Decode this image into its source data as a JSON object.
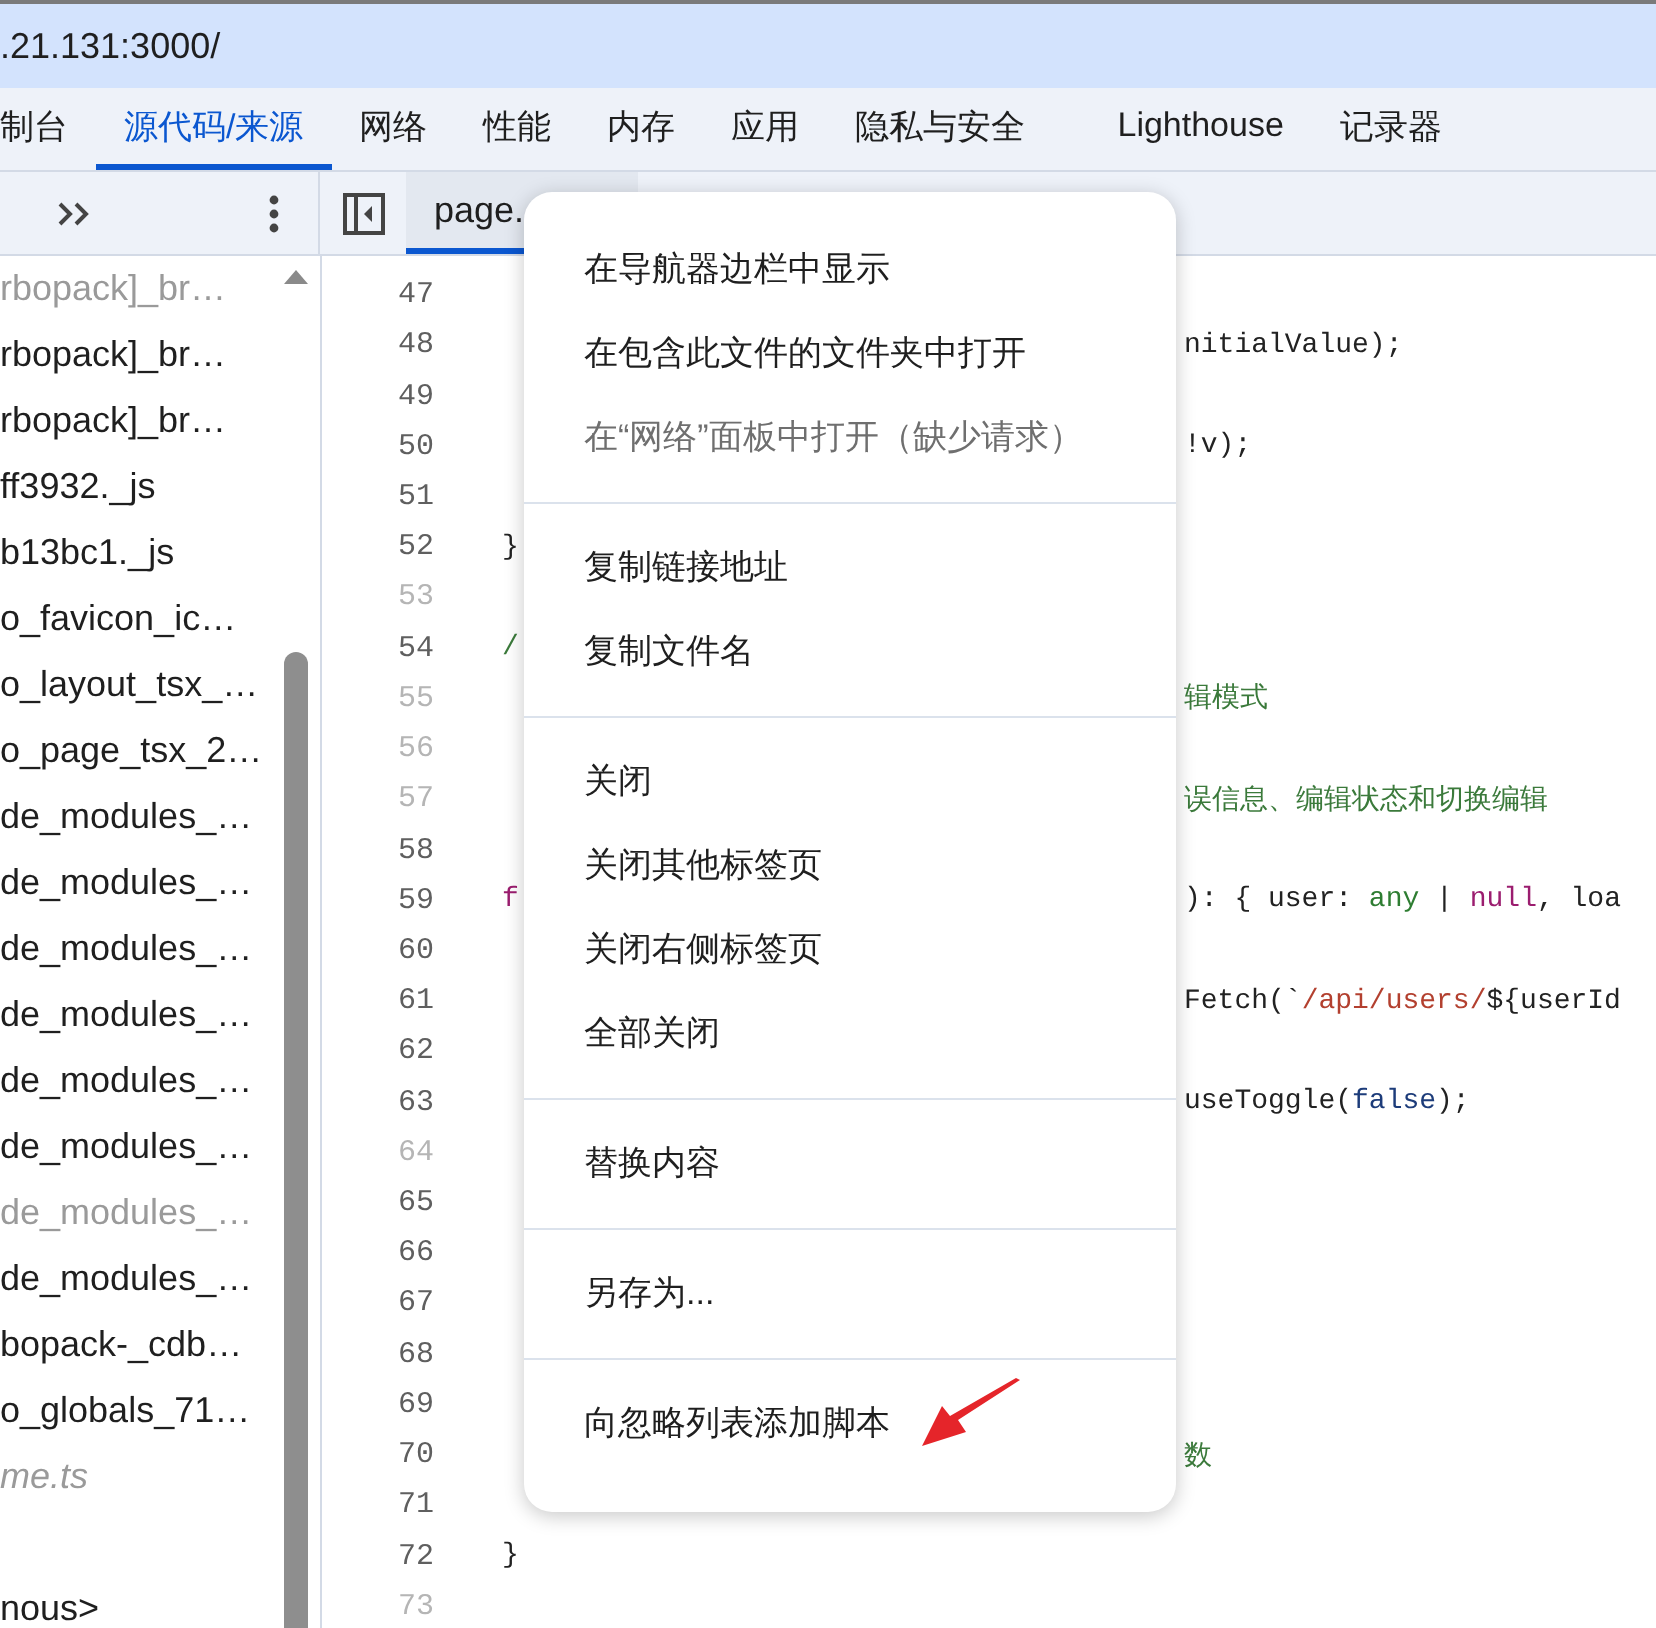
{
  "address_bar": {
    "url": ".21.131:3000/"
  },
  "panel_tabs": [
    {
      "label": "制台",
      "selected": false
    },
    {
      "label": "源代码/来源",
      "selected": true
    },
    {
      "label": "网络",
      "selected": false
    },
    {
      "label": "性能",
      "selected": false
    },
    {
      "label": "内存",
      "selected": false
    },
    {
      "label": "应用",
      "selected": false
    },
    {
      "label": "隐私与安全",
      "selected": false
    },
    {
      "label": "Lighthouse",
      "selected": false
    },
    {
      "label": "记录器",
      "selected": false
    }
  ],
  "editor_tabs": [
    {
      "label": "page.",
      "selected": true
    }
  ],
  "navigator": {
    "items": [
      {
        "label": "rbopack]_br…",
        "kind": "file",
        "dim": true,
        "italic": false
      },
      {
        "label": "rbopack]_br…",
        "kind": "file",
        "dim": false,
        "italic": false
      },
      {
        "label": "rbopack]_br…",
        "kind": "file",
        "dim": false,
        "italic": false
      },
      {
        "label": "ff3932._js",
        "kind": "file",
        "dim": false,
        "italic": false
      },
      {
        "label": "b13bc1._js",
        "kind": "file",
        "dim": false,
        "italic": false
      },
      {
        "label": "o_favicon_ic…",
        "kind": "file",
        "dim": false,
        "italic": false
      },
      {
        "label": "o_layout_tsx_…",
        "kind": "file",
        "dim": false,
        "italic": false
      },
      {
        "label": "o_page_tsx_2…",
        "kind": "file",
        "dim": false,
        "italic": false
      },
      {
        "label": "de_modules_…",
        "kind": "file",
        "dim": false,
        "italic": false
      },
      {
        "label": "de_modules_…",
        "kind": "file",
        "dim": false,
        "italic": false
      },
      {
        "label": "de_modules_…",
        "kind": "file",
        "dim": false,
        "italic": false
      },
      {
        "label": "de_modules_…",
        "kind": "file",
        "dim": false,
        "italic": false
      },
      {
        "label": "de_modules_…",
        "kind": "file",
        "dim": false,
        "italic": false
      },
      {
        "label": "de_modules_…",
        "kind": "file",
        "dim": false,
        "italic": false
      },
      {
        "label": "de_modules_…",
        "kind": "file",
        "dim": true,
        "italic": false
      },
      {
        "label": "de_modules_…",
        "kind": "file",
        "dim": false,
        "italic": false
      },
      {
        "label": "bopack-_cdb…",
        "kind": "file",
        "dim": false,
        "italic": false
      },
      {
        "label": "o_globals_71…",
        "kind": "file",
        "dim": false,
        "italic": false
      },
      {
        "label": "me.ts",
        "kind": "file",
        "dim": true,
        "italic": true
      },
      {
        "label": "nous>",
        "kind": "group",
        "dim": false,
        "italic": false
      }
    ]
  },
  "code_lines": [
    {
      "number": "47",
      "dim": false
    },
    {
      "number": "48",
      "dim": false,
      "right": [
        {
          "kind": "plain",
          "text": "nitialValue);"
        }
      ]
    },
    {
      "number": "49",
      "dim": false
    },
    {
      "number": "50",
      "dim": false,
      "right": [
        {
          "kind": "plain",
          "text": "!v);"
        }
      ]
    },
    {
      "number": "51",
      "dim": false
    },
    {
      "number": "52",
      "dim": false,
      "left": [
        {
          "kind": "plain",
          "text": "}"
        }
      ]
    },
    {
      "number": "53",
      "dim": true
    },
    {
      "number": "54",
      "dim": false,
      "left": [
        {
          "kind": "comment",
          "text": "/"
        }
      ]
    },
    {
      "number": "55",
      "dim": true,
      "right": [
        {
          "kind": "comment",
          "text": "辑模式"
        }
      ]
    },
    {
      "number": "56",
      "dim": true
    },
    {
      "number": "57",
      "dim": true,
      "right": [
        {
          "kind": "comment",
          "text": "误信息、编辑状态和切换编辑"
        }
      ]
    },
    {
      "number": "58",
      "dim": false
    },
    {
      "number": "59",
      "dim": false,
      "left": [
        {
          "kind": "keyword",
          "text": "f"
        }
      ],
      "right": [
        {
          "kind": "plain",
          "text": "): { user: "
        },
        {
          "kind": "type",
          "text": "any"
        },
        {
          "kind": "plain",
          "text": " | "
        },
        {
          "kind": "keyword",
          "text": "null"
        },
        {
          "kind": "plain",
          "text": ", loa"
        }
      ]
    },
    {
      "number": "60",
      "dim": false
    },
    {
      "number": "61",
      "dim": false,
      "right": [
        {
          "kind": "plain",
          "text": "Fetch(`"
        },
        {
          "kind": "string",
          "text": "/api/users/"
        },
        {
          "kind": "plain",
          "text": "${userId"
        }
      ]
    },
    {
      "number": "62",
      "dim": false
    },
    {
      "number": "63",
      "dim": false,
      "right": [
        {
          "kind": "plain",
          "text": "useToggle("
        },
        {
          "kind": "literal",
          "text": "false"
        },
        {
          "kind": "plain",
          "text": ");"
        }
      ]
    },
    {
      "number": "64",
      "dim": true
    },
    {
      "number": "65",
      "dim": false
    },
    {
      "number": "66",
      "dim": false
    },
    {
      "number": "67",
      "dim": false
    },
    {
      "number": "68",
      "dim": false
    },
    {
      "number": "69",
      "dim": false
    },
    {
      "number": "70",
      "dim": false,
      "right": [
        {
          "kind": "comment",
          "text": "数"
        }
      ]
    },
    {
      "number": "71",
      "dim": false
    },
    {
      "number": "72",
      "dim": false,
      "left": [
        {
          "kind": "plain",
          "text": "}"
        }
      ]
    },
    {
      "number": "73",
      "dim": true
    }
  ],
  "context_menu": {
    "groups": [
      [
        {
          "label": "在导航器边栏中显示",
          "disabled": false
        },
        {
          "label": "在包含此文件的文件夹中打开",
          "disabled": false
        },
        {
          "label": "在“网络”面板中打开（缺少请求）",
          "disabled": true
        }
      ],
      [
        {
          "label": "复制链接地址",
          "disabled": false
        },
        {
          "label": "复制文件名",
          "disabled": false
        }
      ],
      [
        {
          "label": "关闭",
          "disabled": false
        },
        {
          "label": "关闭其他标签页",
          "disabled": false
        },
        {
          "label": "关闭右侧标签页",
          "disabled": false
        },
        {
          "label": "全部关闭",
          "disabled": false
        }
      ],
      [
        {
          "label": "替换内容",
          "disabled": false
        }
      ],
      [
        {
          "label": "另存为...",
          "disabled": false
        }
      ],
      [
        {
          "label": "向忽略列表添加脚本",
          "disabled": false
        }
      ]
    ]
  }
}
